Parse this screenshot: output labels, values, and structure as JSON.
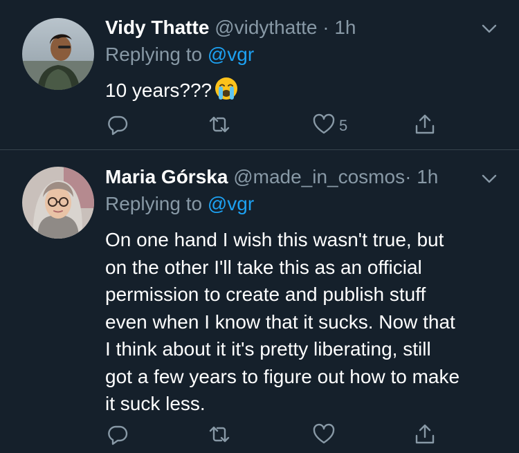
{
  "colors": {
    "background": "#15202b",
    "muted": "#8899a6",
    "accent": "#1da1f2",
    "divider": "#38444d"
  },
  "tweets": [
    {
      "name": "Vidy Thatte",
      "handle": "@vidythatte",
      "dot": "·",
      "time": "1h",
      "replying_prefix": "Replying to",
      "replying_to": "@vgr",
      "text": "10 years???",
      "emoji": "loudly-crying-face",
      "reply_count": "",
      "retweet_count": "",
      "like_count": "5",
      "icons": [
        "reply-icon",
        "retweet-icon",
        "heart-icon",
        "share-icon",
        "chevron-down-icon"
      ]
    },
    {
      "name": "Maria Górska",
      "handle": "@made_in_cosmos",
      "dot": "·",
      "time": "1h",
      "replying_prefix": "Replying to",
      "replying_to": "@vgr",
      "text_lines": [
        "On one hand I wish this wasn't true, but",
        "on the other I'll take this as an official",
        "permission to create and publish stuff",
        "even when I know that it sucks. Now that",
        "I think about it it's pretty liberating, still",
        "got a few years to figure out how to make",
        "it suck less."
      ],
      "reply_count": "",
      "retweet_count": "",
      "like_count": "",
      "icons": [
        "reply-icon",
        "retweet-icon",
        "heart-icon",
        "share-icon",
        "chevron-down-icon"
      ]
    }
  ]
}
